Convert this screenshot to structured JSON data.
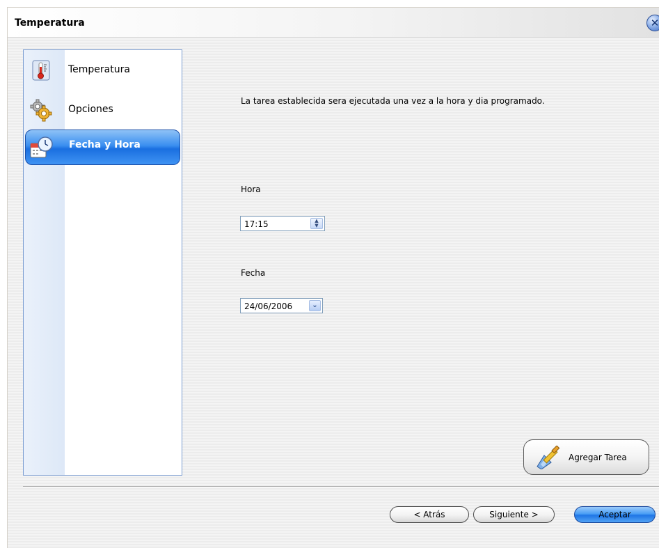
{
  "window": {
    "title": "Temperatura",
    "close_glyph": "✕"
  },
  "sidebar": {
    "items": [
      {
        "label": "Temperatura",
        "icon": "thermometer-icon",
        "selected": false
      },
      {
        "label": "Opciones",
        "icon": "gears-icon",
        "selected": false
      },
      {
        "label": "Fecha y Hora",
        "icon": "calendar-clock-icon",
        "selected": true
      }
    ]
  },
  "main": {
    "description": "La tarea establecida sera ejecutada una vez a la hora y dia programado.",
    "hora": {
      "label": "Hora",
      "value": "17:15"
    },
    "fecha": {
      "label": "Fecha",
      "value": "24/06/2006"
    },
    "agregar_label": "Agregar Tarea"
  },
  "footer": {
    "back_label": "< Atrás",
    "next_label": "Siguiente >",
    "accept_label": "Aceptar"
  },
  "colors": {
    "accent": "#2a7fec",
    "sidebar_border": "#7a9cd0"
  }
}
